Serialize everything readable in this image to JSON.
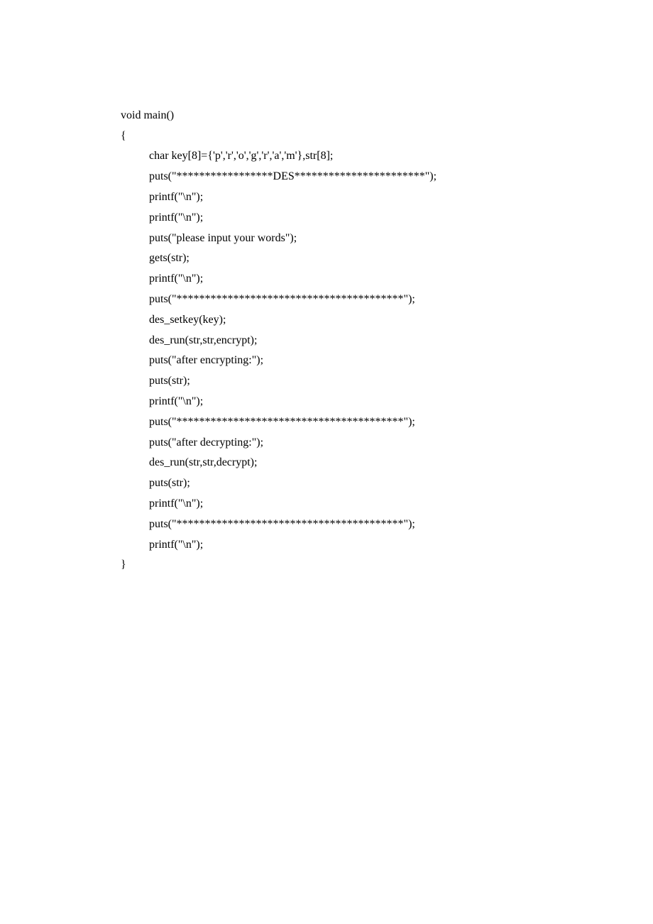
{
  "code": {
    "lines": [
      {
        "indent": 0,
        "text": "void main()"
      },
      {
        "indent": 0,
        "text": "{"
      },
      {
        "indent": 1,
        "text": "char key[8]={'p','r','o','g','r','a','m'},str[8];"
      },
      {
        "indent": 1,
        "text": "puts(\"*****************DES***********************\");"
      },
      {
        "indent": 1,
        "text": "printf(\"\\n\");"
      },
      {
        "indent": 1,
        "text": "printf(\"\\n\");"
      },
      {
        "indent": 1,
        "text": "puts(\"please input your words\");"
      },
      {
        "indent": 1,
        "text": "gets(str);"
      },
      {
        "indent": 1,
        "text": "printf(\"\\n\");"
      },
      {
        "indent": 1,
        "text": "puts(\"****************************************\");"
      },
      {
        "indent": 1,
        "text": "des_setkey(key);"
      },
      {
        "indent": 1,
        "text": "des_run(str,str,encrypt);"
      },
      {
        "indent": 1,
        "text": "puts(\"after encrypting:\");"
      },
      {
        "indent": 1,
        "text": "puts(str);"
      },
      {
        "indent": 1,
        "text": "printf(\"\\n\");"
      },
      {
        "indent": 1,
        "text": "puts(\"****************************************\");"
      },
      {
        "indent": 1,
        "text": "puts(\"after decrypting:\");"
      },
      {
        "indent": 1,
        "text": "des_run(str,str,decrypt);"
      },
      {
        "indent": 1,
        "text": "puts(str);"
      },
      {
        "indent": 1,
        "text": "printf(\"\\n\");"
      },
      {
        "indent": 1,
        "text": "puts(\"****************************************\");"
      },
      {
        "indent": 1,
        "text": "printf(\"\\n\");"
      },
      {
        "indent": 0,
        "text": "}"
      }
    ]
  }
}
